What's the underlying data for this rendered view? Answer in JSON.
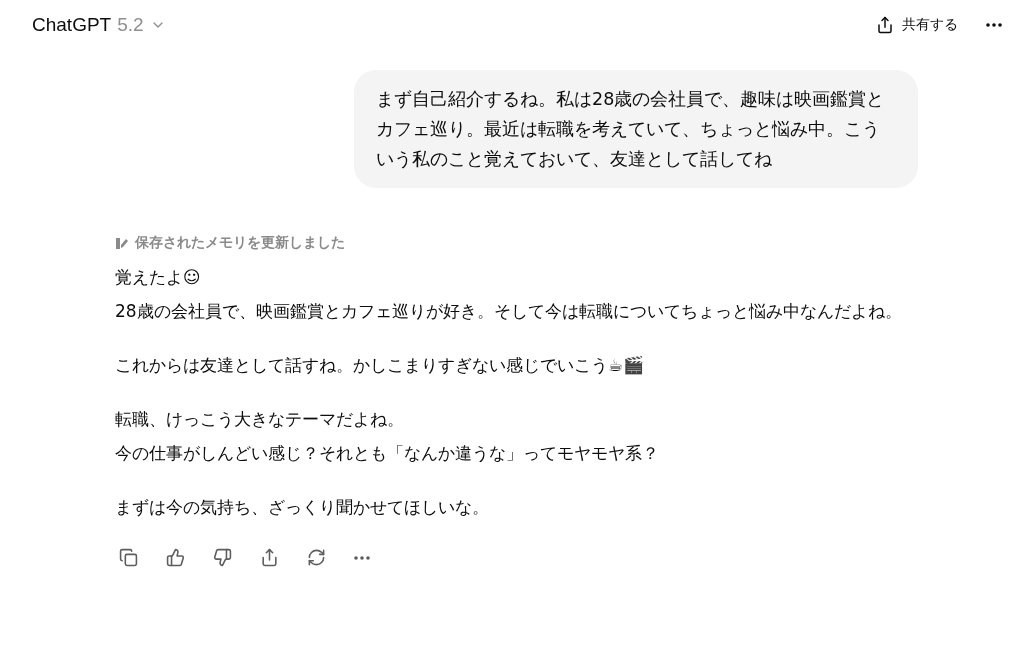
{
  "header": {
    "title": "ChatGPT",
    "version": "5.2",
    "share_label": "共有する"
  },
  "user_message": "まず自己紹介するね。私は28歳の会社員で、趣味は映画鑑賞とカフェ巡り。最近は転職を考えていて、ちょっと悩み中。こういう私のこと覚えておいて、友達として話してね",
  "memory_note": "保存されたメモリを更新しました",
  "assistant_paragraphs": [
    [
      "覚えたよ☺",
      "28歳の会社員で、映画鑑賞とカフェ巡りが好き。そして今は転職についてちょっと悩み中なんだよね。"
    ],
    [
      "これからは友達として話すね。かしこまりすぎない感じでいこう☕🎬"
    ],
    [
      "転職、けっこう大きなテーマだよね。",
      "今の仕事がしんどい感じ？それとも「なんか違うな」ってモヤモヤ系？"
    ],
    [
      "まずは今の気持ち、ざっくり聞かせてほしいな。"
    ]
  ]
}
